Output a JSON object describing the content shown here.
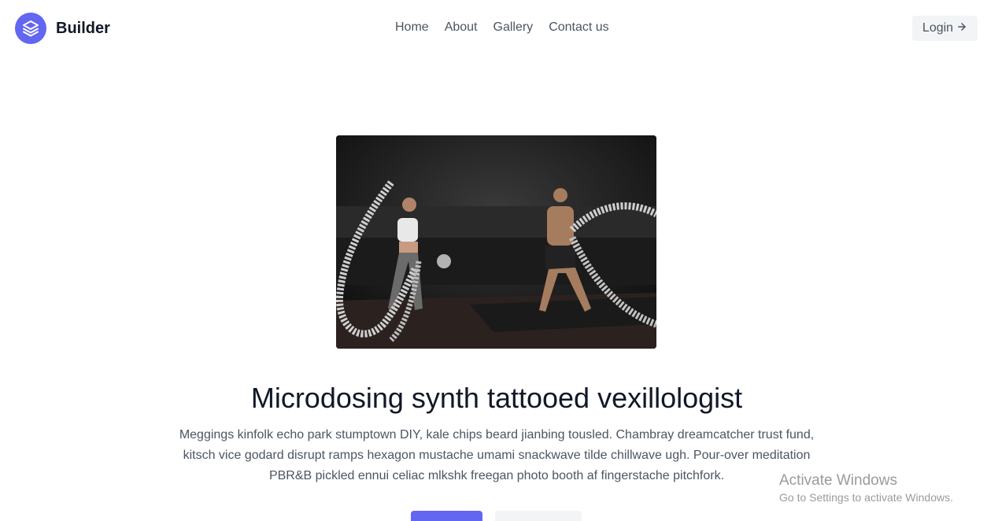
{
  "brand": {
    "name": "Builder",
    "logo_icon": "stack-layers-icon"
  },
  "nav": {
    "items": [
      {
        "label": "Home"
      },
      {
        "label": "About"
      },
      {
        "label": "Gallery"
      },
      {
        "label": "Contact us"
      }
    ]
  },
  "header": {
    "login_label": "Login",
    "login_icon": "arrow-right-icon"
  },
  "hero": {
    "image_subject": "two people training with battle ropes in a dark gym",
    "title": "Microdosing synth tattooed vexillologist",
    "paragraph_lines": [
      "Meggings kinfolk echo park stumptown DIY, kale chips beard jianbing tousled. Chambray dreamcatcher trust fund,",
      "kitsch vice godard disrupt ramps hexagon mustache umami snackwave tilde chillwave ugh. Pour-over meditation",
      "PBR&B pickled ennui celiac mlkshk freegan photo booth af fingerstache pitchfork."
    ],
    "primary_button_label": "",
    "secondary_button_label": ""
  },
  "watermark": {
    "title": "Activate Windows",
    "subtitle": "Go to Settings to activate Windows."
  },
  "colors": {
    "accent": "#6366f1",
    "heading": "#111827",
    "text": "#4b5563",
    "muted_bg": "#f3f4f6"
  }
}
